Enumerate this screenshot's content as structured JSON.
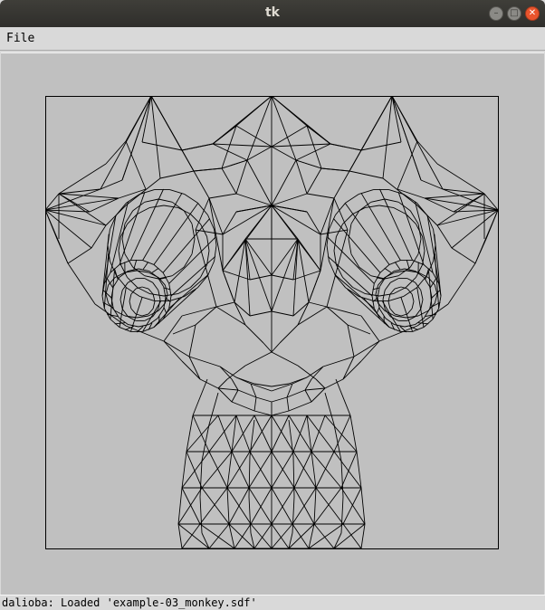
{
  "window": {
    "title": "tk",
    "minimize_icon": "minimize-icon",
    "maximize_icon": "maximize-icon",
    "close_icon": "close-icon"
  },
  "menu": {
    "items": [
      "File"
    ]
  },
  "viewport": {
    "content": "monkey-head-wireframe",
    "background": "#c0c0c0",
    "line_color": "#000000"
  },
  "status": {
    "text": "dalioba: Loaded 'example-03_monkey.sdf'"
  }
}
